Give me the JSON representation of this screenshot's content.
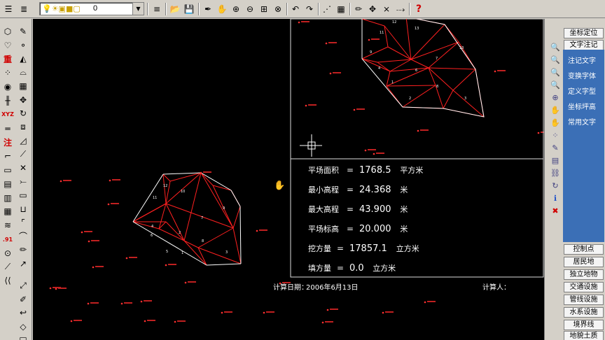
{
  "toolbar": {
    "layer_value": "0",
    "icons": [
      "layers-icon",
      "layer-manager-icon",
      "bulb-icon",
      "sun-icon",
      "freeze-icon",
      "lock-icon",
      "color-icon",
      "menu-icon",
      "open-icon",
      "save-icon",
      "pen-icon",
      "pan-icon",
      "zoom-in-icon",
      "zoom-out-icon",
      "zoom-window-icon",
      "zoom-all-icon",
      "undo-icon",
      "redo-icon",
      "snap-icon",
      "grid-icon",
      "edit-icon",
      "move-icon",
      "trim-icon",
      "extend-icon",
      "help-icon"
    ],
    "help_label": "?"
  },
  "left_tools": {
    "col1": [
      {
        "icon": "tag-icon",
        "glyph": "⬡"
      },
      {
        "icon": "heart-icon",
        "glyph": "♡"
      },
      {
        "icon": "heavy-label-icon",
        "glyph": "重"
      },
      {
        "icon": "dots-icon",
        "glyph": "⁘"
      },
      {
        "icon": "point-icon",
        "glyph": "◉"
      },
      {
        "icon": "ladder-icon",
        "glyph": "╫"
      },
      {
        "icon": "xyz-icon",
        "glyph": "XYZ"
      },
      {
        "icon": "line-icon",
        "glyph": "═"
      },
      {
        "icon": "annotate-label-icon",
        "glyph": "注"
      },
      {
        "icon": "corner-icon",
        "glyph": "⌐"
      },
      {
        "icon": "rect-icon",
        "glyph": "▭"
      },
      {
        "icon": "fence-icon",
        "glyph": "▤"
      },
      {
        "icon": "rail-icon",
        "glyph": "▥"
      },
      {
        "icon": "stair-icon",
        "glyph": "▦"
      },
      {
        "icon": "road-icon",
        "glyph": "≋"
      },
      {
        "icon": "elevation-icon",
        "glyph": ".91"
      },
      {
        "icon": "circle-icon",
        "glyph": "⊙"
      },
      {
        "icon": "slope-icon",
        "glyph": "⟋"
      },
      {
        "icon": "double-line-icon",
        "glyph": "⟨⟨"
      }
    ],
    "col2": [
      {
        "icon": "brush-icon",
        "glyph": "✎"
      },
      {
        "icon": "node-icon",
        "glyph": "⚬"
      },
      {
        "icon": "triangle-icon",
        "glyph": "◭"
      },
      {
        "icon": "arch-icon",
        "glyph": "⌓"
      },
      {
        "icon": "grid-icon",
        "glyph": "▦"
      },
      {
        "icon": "move-icon",
        "glyph": "✥"
      },
      {
        "icon": "rotate-icon",
        "glyph": "↻"
      },
      {
        "icon": "scale-icon",
        "glyph": "⧈"
      },
      {
        "icon": "skew-icon",
        "glyph": "◿"
      },
      {
        "icon": "draw-line-icon",
        "glyph": "⟋"
      },
      {
        "icon": "cross-line-icon",
        "glyph": "✕"
      },
      {
        "icon": "break-icon",
        "glyph": "⤚"
      },
      {
        "icon": "box-icon",
        "glyph": "▭"
      },
      {
        "icon": "tray-icon",
        "glyph": "⊔"
      },
      {
        "icon": "corner-line-icon",
        "glyph": "⌜"
      },
      {
        "icon": "arc-icon",
        "glyph": "⌒"
      },
      {
        "icon": "pencil-icon",
        "glyph": "✏"
      },
      {
        "icon": "arrow-line-icon",
        "glyph": "↗"
      },
      {
        "icon": "arrow-double-icon",
        "glyph": "⤢"
      },
      {
        "icon": "ruler-icon",
        "glyph": "✐"
      },
      {
        "icon": "back-arrow-icon",
        "glyph": "↩"
      },
      {
        "icon": "diamond-icon",
        "glyph": "◇"
      },
      {
        "icon": "square-icon",
        "glyph": "□"
      }
    ]
  },
  "canvas": {
    "results": {
      "rows": [
        {
          "label": "平场面积",
          "eq": "=",
          "value": "1768.5",
          "unit": "平方米"
        },
        {
          "label": "最小高程",
          "eq": "=",
          "value": "24.368",
          "unit": "米"
        },
        {
          "label": "最大高程",
          "eq": "=",
          "value": "43.900",
          "unit": "米"
        },
        {
          "label": "平场标高",
          "eq": "=",
          "value": "20.000",
          "unit": "米"
        },
        {
          "label": "挖方量",
          "eq": "=",
          "value": "17857.1",
          "unit": "立方米"
        },
        {
          "label": "填方量",
          "eq": "=",
          "value": "0.0",
          "unit": "立方米"
        }
      ]
    },
    "calc_date_label": "计算日期：",
    "calc_date": "2006年6月13日",
    "calc_person_label": "计算人：",
    "triangle_numbers": [
      "11",
      "12",
      "10",
      "9",
      "4",
      "7",
      "8",
      "6",
      "5",
      "1",
      "2",
      "3"
    ],
    "detail_numbers": [
      "11",
      "12",
      "13",
      "10",
      "9",
      "7",
      "6",
      "4",
      "1",
      "2",
      "8",
      "3"
    ],
    "colors": {
      "background": "#000000",
      "mesh": "#ff2020",
      "boundary": "#ffffff",
      "text": "#ffffff",
      "points": "#ff3030"
    }
  },
  "right_icons": [
    "search-icon",
    "search-icon",
    "search-icon",
    "search-icon",
    "zoom-icon",
    "hand-icon",
    "hand-icon",
    "node-icon",
    "edit-icon",
    "layers-icon",
    "link-icon",
    "refresh-icon",
    "info-icon",
    "delete-icon"
  ],
  "right_panel": {
    "tabs": [
      "坐标定位",
      "文字注记"
    ],
    "items": [
      "注记文字",
      "变换字体",
      "定义字型",
      "坐标坪高",
      "常用文字"
    ],
    "categories": [
      "控制点",
      "居民地",
      "独立地物",
      "交通设施",
      "管线设施",
      "水系设施",
      "境界线",
      "地貌土质"
    ]
  }
}
